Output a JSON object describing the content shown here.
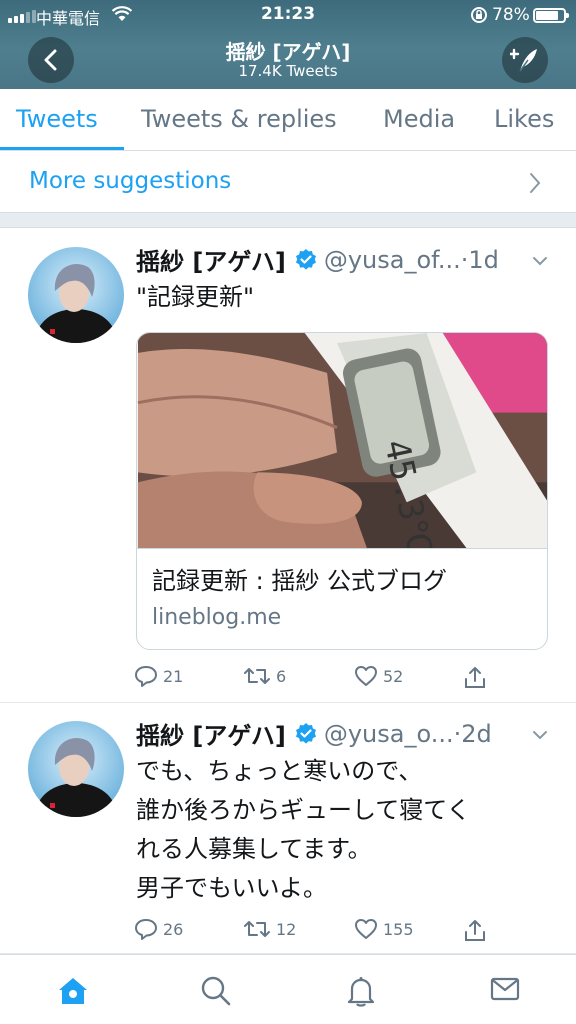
{
  "status_bar": {
    "carrier": "中華電信",
    "time": "21:23",
    "battery_percent": "78%",
    "battery_level": 0.78
  },
  "header": {
    "title": "揺紗 [アゲハ]",
    "subtitle": "17.4K Tweets",
    "back_icon": "chevron-left-icon",
    "compose_icon": "compose-feather-icon"
  },
  "tabs": [
    {
      "label": "Tweets",
      "active": true
    },
    {
      "label": "Tweets & replies",
      "active": false
    },
    {
      "label": "Media",
      "active": false
    },
    {
      "label": "Likes",
      "active": false
    }
  ],
  "suggestions": {
    "label": "More suggestions"
  },
  "tweets": [
    {
      "name": "揺紗 [アゲハ]",
      "handle": "@yusa_of...",
      "time": "·1d",
      "text": "\"記録更新\"",
      "card": {
        "title": "記録更新 : 揺紗 公式ブログ",
        "domain": "lineblog.me"
      },
      "replies": "21",
      "retweets": "6",
      "likes": "52"
    },
    {
      "name": "揺紗 [アゲハ]",
      "handle": "@yusa_o...",
      "time": "·2d",
      "text": "でも、ちょっと寒いので、\n誰か後ろからギューして寝てく\nれる人募集してます。\n男子でもいいよ。",
      "replies": "26",
      "retweets": "12",
      "likes": "155"
    }
  ],
  "bottom_nav": [
    {
      "icon": "home-icon",
      "active": true
    },
    {
      "icon": "search-icon",
      "active": false
    },
    {
      "icon": "notifications-bell-icon",
      "active": false
    },
    {
      "icon": "messages-envelope-icon",
      "active": false
    }
  ],
  "colors": {
    "accent": "#1da1f2",
    "header": "#4a7686",
    "muted": "#657786"
  }
}
